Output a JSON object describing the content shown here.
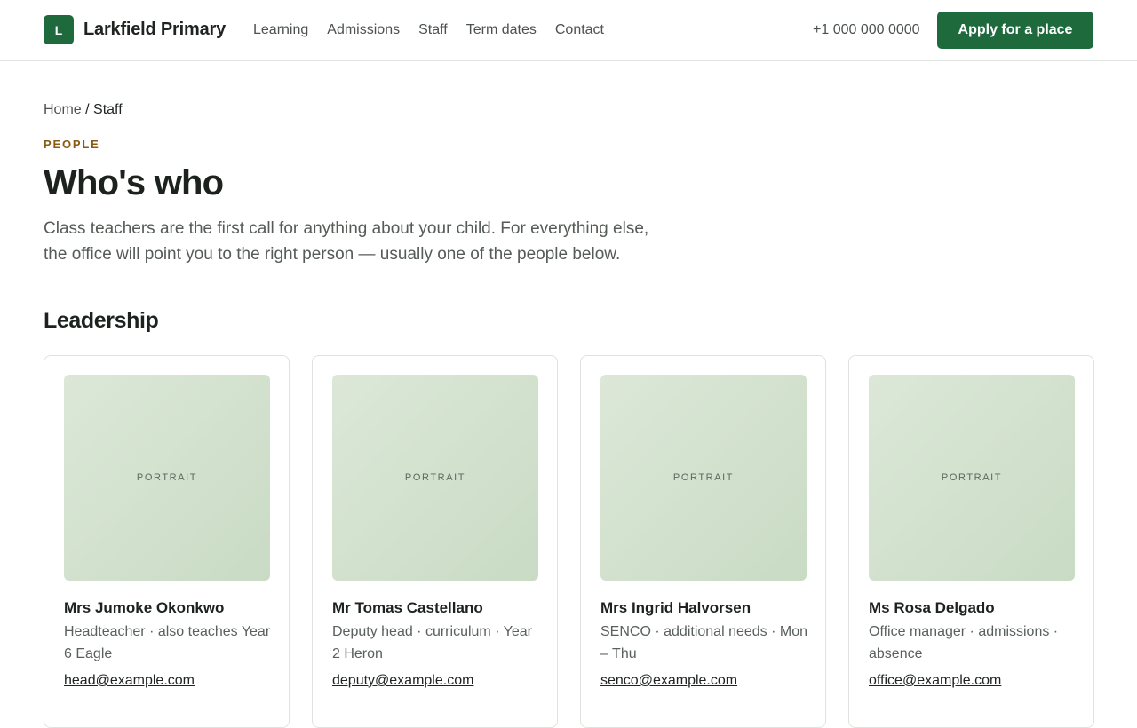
{
  "header": {
    "logo_letter": "L",
    "brand": "Larkfield Primary",
    "nav": [
      "Learning",
      "Admissions",
      "Staff",
      "Term dates",
      "Contact"
    ],
    "phone": "+1 000 000 0000",
    "apply_label": "Apply for a place"
  },
  "breadcrumb": {
    "home": "Home",
    "separator": " / ",
    "current": "Staff"
  },
  "eyebrow": "PEOPLE",
  "title": "Who's who",
  "intro": "Class teachers are the first call for anything about your child. For everything else, the office will point you to the right person — usually one of the people below.",
  "section_title": "Leadership",
  "staff": [
    {
      "portrait_label": "PORTRAIT",
      "name": "Mrs Jumoke Okonkwo",
      "role": "Headteacher · also teaches Year 6 Eagle",
      "email": "head@example.com"
    },
    {
      "portrait_label": "PORTRAIT",
      "name": "Mr Tomas Castellano",
      "role": "Deputy head · curriculum · Year 2 Heron",
      "email": "deputy@example.com"
    },
    {
      "portrait_label": "PORTRAIT",
      "name": "Mrs Ingrid Halvorsen",
      "role": "SENCO · additional needs · Mon – Thu",
      "email": "senco@example.com"
    },
    {
      "portrait_label": "PORTRAIT",
      "name": "Ms Rosa Delgado",
      "role": "Office manager · admissions · absence",
      "email": "office@example.com"
    }
  ],
  "colors": {
    "brand_green": "#1f6a3c",
    "eyebrow": "#8a5a12",
    "portrait_bg": "#d3e2cf"
  }
}
